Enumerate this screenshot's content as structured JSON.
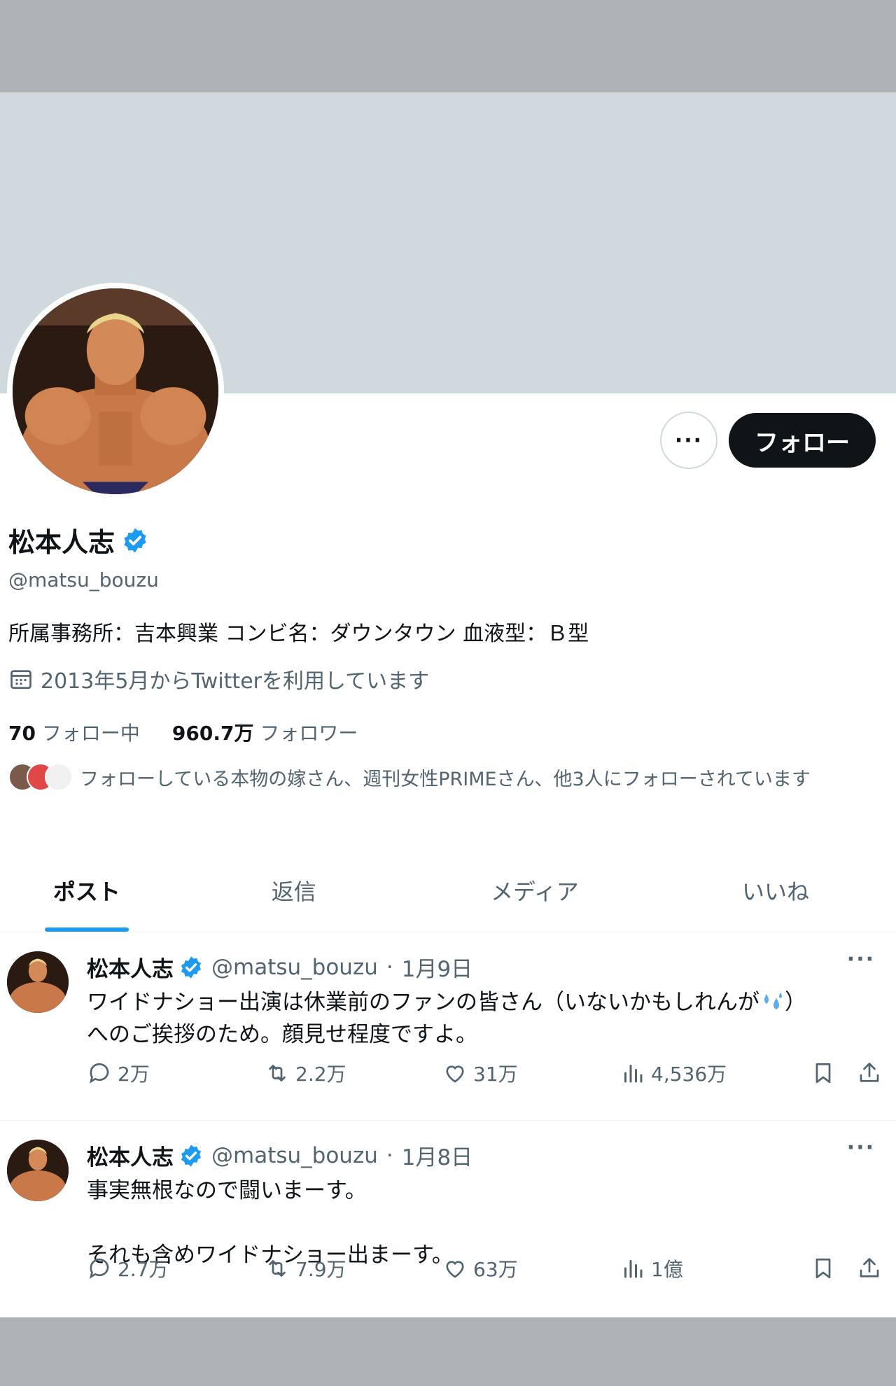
{
  "profile": {
    "display_name": "松本人志",
    "handle": "@matsu_bouzu",
    "bio": "所属事務所：吉本興業 コンビ名：ダウンタウン 血液型：Ｂ型",
    "joined": "2013年5月からTwitterを利用しています",
    "following_count": "70",
    "following_label": "フォロー中",
    "followers_count": "960.7万",
    "followers_label": "フォロワー",
    "followed_by": "フォローしている本物の嫁さん、週刊女性PRIMEさん、他3人にフォローされています",
    "more_glyph": "···",
    "follow_button": "フォロー"
  },
  "colors": {
    "accent": "#1d9bf0",
    "banner": "#cfd9de",
    "text_secondary": "#536471"
  },
  "icons": [
    "more-icon",
    "verified-badge-icon",
    "calendar-icon",
    "reply-icon",
    "repost-icon",
    "like-icon",
    "views-icon",
    "bookmark-icon",
    "share-icon",
    "sweat-droplets-emoji"
  ],
  "tabs": [
    {
      "label": "ポスト",
      "active": true
    },
    {
      "label": "返信"
    },
    {
      "label": "メディア"
    },
    {
      "label": "いいね"
    }
  ],
  "tweets": [
    {
      "name": "松本人志",
      "handle": "@matsu_bouzu",
      "separator": "·",
      "date": "1月9日",
      "more": "···",
      "text_part1": "ワイドナショー出演は休業前のファンの皆さん（いないかもしれんが",
      "text_part2": "）\nへのご挨拶のため。顔見せ程度ですよ。",
      "replies": "2万",
      "reposts": "2.2万",
      "likes": "31万",
      "views": "4,536万"
    },
    {
      "name": "松本人志",
      "handle": "@matsu_bouzu",
      "separator": "·",
      "date": "1月8日",
      "more": "···",
      "text": "事実無根なので闘いまーす。\n\nそれも含めワイドナショー出まーす。",
      "replies": "2.7万",
      "reposts": "7.9万",
      "likes": "63万",
      "views": "1億"
    }
  ]
}
